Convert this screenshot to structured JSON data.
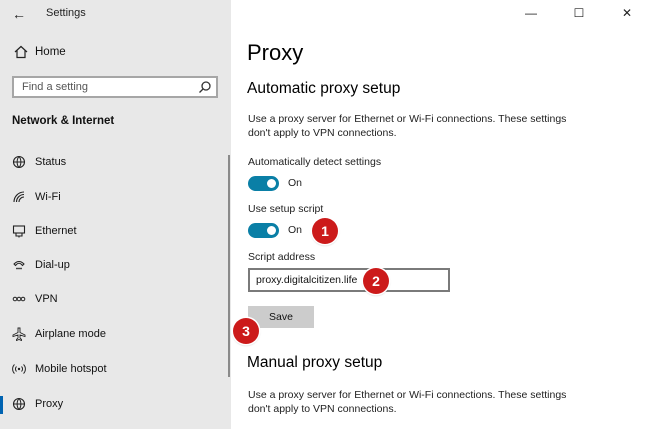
{
  "window": {
    "title": "Settings",
    "minimize_glyph": "—",
    "maximize_glyph": "☐",
    "close_glyph": "✕",
    "back_glyph": "←"
  },
  "sidebar": {
    "home_label": "Home",
    "search": {
      "placeholder": "Find a setting"
    },
    "section_title": "Network & Internet",
    "items": [
      {
        "label": "Status",
        "icon": "globe-status-icon"
      },
      {
        "label": "Wi-Fi",
        "icon": "wifi-icon"
      },
      {
        "label": "Ethernet",
        "icon": "ethernet-icon"
      },
      {
        "label": "Dial-up",
        "icon": "dialup-icon"
      },
      {
        "label": "VPN",
        "icon": "vpn-icon"
      },
      {
        "label": "Airplane mode",
        "icon": "airplane-icon"
      },
      {
        "label": "Mobile hotspot",
        "icon": "hotspot-icon"
      },
      {
        "label": "Proxy",
        "icon": "globe-icon",
        "active": true
      }
    ]
  },
  "main": {
    "page_title": "Proxy",
    "auto": {
      "heading": "Automatic proxy setup",
      "description": "Use a proxy server for Ethernet or Wi-Fi connections. These settings don't apply to VPN connections.",
      "detect_label": "Automatically detect settings",
      "detect_state": "On",
      "script_label": "Use setup script",
      "script_state": "On",
      "address_label": "Script address",
      "address_value": "proxy.digitalcitizen.life",
      "save_label": "Save"
    },
    "manual": {
      "heading": "Manual proxy setup",
      "description": "Use a proxy server for Ethernet or Wi-Fi connections. These settings don't apply to VPN connections."
    }
  },
  "annotations": {
    "one": "1",
    "two": "2",
    "three": "3"
  },
  "colors": {
    "accent": "#0063b1",
    "toggle_on": "#0a7fa6",
    "badge": "#cc1a1a",
    "sidebar_bg": "#e8e8e8"
  }
}
